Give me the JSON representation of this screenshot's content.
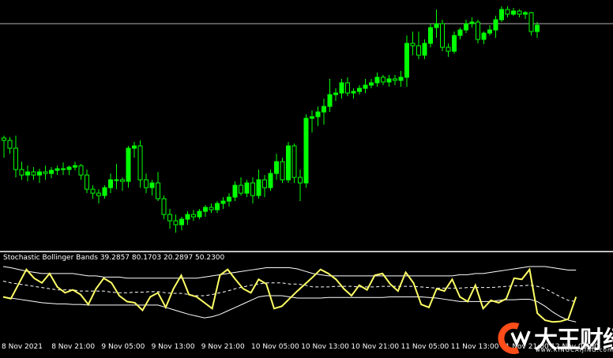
{
  "indicator": {
    "name": "Stochastic Bollinger Bands",
    "values": "39.2857 80.1703 20.2897 50.2300"
  },
  "time_axis": [
    {
      "label": "8 Nov 2021",
      "index": 0
    },
    {
      "label": "8 Nov 21:00",
      "index": 8
    },
    {
      "label": "9 Nov 05:00",
      "index": 16
    },
    {
      "label": "9 Nov 13:00",
      "index": 24
    },
    {
      "label": "9 Nov 21:00",
      "index": 32
    },
    {
      "label": "10 Nov 05:00",
      "index": 40
    },
    {
      "label": "10 Nov 13:00",
      "index": 48
    },
    {
      "label": "10 Nov 21:00",
      "index": 56
    },
    {
      "label": "11 Nov 05:00",
      "index": 64
    },
    {
      "label": "11 Nov 13:00",
      "index": 72
    },
    {
      "label": "11 Nov 21:00",
      "index": 80
    },
    {
      "label": "12 Nov 05:00",
      "index": 88
    }
  ],
  "logo": {
    "text": "大王财经",
    "sub": "www.KINGCAIJING.com"
  },
  "colors": {
    "background": "#000000",
    "candle_bull": "#00ff00",
    "candle_bear": "#000000",
    "candle_wick": "#00ff00",
    "candle_bear_outline": "#00ff00",
    "stoch_line": "#ffff66",
    "band_line": "#ffffff",
    "separator": "#c0c0c0",
    "hline": "#b0b0b0"
  },
  "chart_data": {
    "type": "candlestick",
    "candles": [
      {
        "o": 175,
        "h": 172,
        "l": 200,
        "c": 178
      },
      {
        "o": 178,
        "h": 174,
        "l": 195,
        "c": 188
      },
      {
        "o": 188,
        "h": 172,
        "l": 225,
        "c": 215
      },
      {
        "o": 215,
        "h": 205,
        "l": 228,
        "c": 222
      },
      {
        "o": 222,
        "h": 210,
        "l": 230,
        "c": 218
      },
      {
        "o": 218,
        "h": 212,
        "l": 228,
        "c": 222
      },
      {
        "o": 222,
        "h": 214,
        "l": 232,
        "c": 218
      },
      {
        "o": 218,
        "h": 210,
        "l": 228,
        "c": 220
      },
      {
        "o": 220,
        "h": 212,
        "l": 226,
        "c": 216
      },
      {
        "o": 216,
        "h": 210,
        "l": 222,
        "c": 214
      },
      {
        "o": 214,
        "h": 206,
        "l": 222,
        "c": 215
      },
      {
        "o": 215,
        "h": 210,
        "l": 222,
        "c": 212
      },
      {
        "o": 212,
        "h": 205,
        "l": 216,
        "c": 210
      },
      {
        "o": 210,
        "h": 208,
        "l": 228,
        "c": 222
      },
      {
        "o": 222,
        "h": 215,
        "l": 245,
        "c": 240
      },
      {
        "o": 240,
        "h": 235,
        "l": 252,
        "c": 245
      },
      {
        "o": 245,
        "h": 240,
        "l": 258,
        "c": 248
      },
      {
        "o": 248,
        "h": 235,
        "l": 252,
        "c": 238
      },
      {
        "o": 238,
        "h": 220,
        "l": 245,
        "c": 228
      },
      {
        "o": 228,
        "h": 208,
        "l": 240,
        "c": 228
      },
      {
        "o": 228,
        "h": 225,
        "l": 242,
        "c": 230
      },
      {
        "o": 230,
        "h": 185,
        "l": 238,
        "c": 188
      },
      {
        "o": 188,
        "h": 180,
        "l": 200,
        "c": 185
      },
      {
        "o": 185,
        "h": 178,
        "l": 238,
        "c": 228
      },
      {
        "o": 228,
        "h": 220,
        "l": 245,
        "c": 238
      },
      {
        "o": 238,
        "h": 228,
        "l": 248,
        "c": 232
      },
      {
        "o": 232,
        "h": 218,
        "l": 255,
        "c": 252
      },
      {
        "o": 252,
        "h": 248,
        "l": 278,
        "c": 272
      },
      {
        "o": 272,
        "h": 265,
        "l": 290,
        "c": 280
      },
      {
        "o": 280,
        "h": 272,
        "l": 295,
        "c": 285
      },
      {
        "o": 285,
        "h": 275,
        "l": 292,
        "c": 278
      },
      {
        "o": 278,
        "h": 268,
        "l": 285,
        "c": 272
      },
      {
        "o": 272,
        "h": 266,
        "l": 280,
        "c": 275
      },
      {
        "o": 275,
        "h": 265,
        "l": 278,
        "c": 268
      },
      {
        "o": 268,
        "h": 260,
        "l": 275,
        "c": 263
      },
      {
        "o": 263,
        "h": 258,
        "l": 270,
        "c": 266
      },
      {
        "o": 266,
        "h": 255,
        "l": 270,
        "c": 258
      },
      {
        "o": 258,
        "h": 250,
        "l": 265,
        "c": 255
      },
      {
        "o": 255,
        "h": 245,
        "l": 262,
        "c": 250
      },
      {
        "o": 250,
        "h": 230,
        "l": 255,
        "c": 235
      },
      {
        "o": 235,
        "h": 225,
        "l": 248,
        "c": 245
      },
      {
        "o": 245,
        "h": 228,
        "l": 250,
        "c": 232
      },
      {
        "o": 232,
        "h": 225,
        "l": 258,
        "c": 248
      },
      {
        "o": 248,
        "h": 215,
        "l": 252,
        "c": 228
      },
      {
        "o": 228,
        "h": 222,
        "l": 250,
        "c": 238
      },
      {
        "o": 238,
        "h": 215,
        "l": 242,
        "c": 220
      },
      {
        "o": 220,
        "h": 195,
        "l": 228,
        "c": 205
      },
      {
        "o": 205,
        "h": 200,
        "l": 232,
        "c": 228
      },
      {
        "o": 228,
        "h": 180,
        "l": 232,
        "c": 185
      },
      {
        "o": 185,
        "h": 182,
        "l": 232,
        "c": 225
      },
      {
        "o": 225,
        "h": 215,
        "l": 255,
        "c": 232
      },
      {
        "o": 232,
        "h": 145,
        "l": 238,
        "c": 150
      },
      {
        "o": 150,
        "h": 140,
        "l": 168,
        "c": 148
      },
      {
        "o": 148,
        "h": 135,
        "l": 160,
        "c": 142
      },
      {
        "o": 142,
        "h": 125,
        "l": 158,
        "c": 135
      },
      {
        "o": 135,
        "h": 100,
        "l": 142,
        "c": 120
      },
      {
        "o": 120,
        "h": 112,
        "l": 128,
        "c": 118
      },
      {
        "o": 118,
        "h": 100,
        "l": 125,
        "c": 105
      },
      {
        "o": 105,
        "h": 98,
        "l": 122,
        "c": 118
      },
      {
        "o": 118,
        "h": 112,
        "l": 125,
        "c": 116
      },
      {
        "o": 116,
        "h": 108,
        "l": 120,
        "c": 112
      },
      {
        "o": 112,
        "h": 100,
        "l": 118,
        "c": 108
      },
      {
        "o": 108,
        "h": 100,
        "l": 112,
        "c": 105
      },
      {
        "o": 105,
        "h": 92,
        "l": 110,
        "c": 98
      },
      {
        "o": 98,
        "h": 95,
        "l": 108,
        "c": 104
      },
      {
        "o": 104,
        "h": 95,
        "l": 110,
        "c": 100
      },
      {
        "o": 100,
        "h": 95,
        "l": 108,
        "c": 102
      },
      {
        "o": 102,
        "h": 90,
        "l": 110,
        "c": 98
      },
      {
        "o": 98,
        "h": 45,
        "l": 110,
        "c": 55
      },
      {
        "o": 55,
        "h": 40,
        "l": 70,
        "c": 58
      },
      {
        "o": 58,
        "h": 40,
        "l": 75,
        "c": 70
      },
      {
        "o": 70,
        "h": 50,
        "l": 75,
        "c": 55
      },
      {
        "o": 55,
        "h": 30,
        "l": 60,
        "c": 35
      },
      {
        "o": 35,
        "h": 12,
        "l": 48,
        "c": 30
      },
      {
        "o": 30,
        "h": 25,
        "l": 65,
        "c": 60
      },
      {
        "o": 60,
        "h": 55,
        "l": 72,
        "c": 65
      },
      {
        "o": 65,
        "h": 40,
        "l": 68,
        "c": 45
      },
      {
        "o": 45,
        "h": 35,
        "l": 50,
        "c": 38
      },
      {
        "o": 38,
        "h": 25,
        "l": 42,
        "c": 30
      },
      {
        "o": 30,
        "h": 22,
        "l": 35,
        "c": 28
      },
      {
        "o": 28,
        "h": 25,
        "l": 55,
        "c": 50
      },
      {
        "o": 50,
        "h": 40,
        "l": 56,
        "c": 42
      },
      {
        "o": 42,
        "h": 32,
        "l": 45,
        "c": 38
      },
      {
        "o": 38,
        "h": 20,
        "l": 48,
        "c": 25
      },
      {
        "o": 25,
        "h": 8,
        "l": 28,
        "c": 12
      },
      {
        "o": 12,
        "h": 8,
        "l": 22,
        "c": 18
      },
      {
        "o": 18,
        "h": 10,
        "l": 20,
        "c": 14
      },
      {
        "o": 14,
        "h": 12,
        "l": 22,
        "c": 18
      },
      {
        "o": 18,
        "h": 14,
        "l": 24,
        "c": 16
      },
      {
        "o": 16,
        "h": 15,
        "l": 45,
        "c": 40
      },
      {
        "o": 40,
        "h": 28,
        "l": 48,
        "c": 32
      }
    ],
    "stoch": [
      48,
      45,
      70,
      95,
      80,
      72,
      88,
      65,
      55,
      60,
      52,
      35,
      62,
      80,
      72,
      50,
      40,
      38,
      25,
      48,
      55,
      30,
      62,
      85,
      52,
      48,
      38,
      28,
      85,
      95,
      78,
      62,
      55,
      78,
      70,
      28,
      32,
      45,
      58,
      70,
      82,
      95,
      88,
      78,
      62,
      50,
      68,
      60,
      85,
      88,
      70,
      58,
      90,
      72,
      35,
      30,
      62,
      58,
      78,
      48,
      40,
      68,
      28,
      42,
      38,
      45,
      80,
      78,
      95,
      20,
      8,
      5,
      6,
      10,
      48
    ],
    "band_upper": [
      100,
      98,
      95,
      92,
      90,
      88,
      88,
      88,
      88,
      88,
      86,
      84,
      84,
      82,
      82,
      82,
      80,
      80,
      80,
      80,
      80,
      80,
      80,
      80,
      80,
      80,
      82,
      84,
      86,
      88,
      90,
      92,
      94,
      96,
      98,
      98,
      98,
      98,
      96,
      92,
      88,
      86,
      84,
      84,
      84,
      84,
      84,
      84,
      84,
      84,
      84,
      84,
      84,
      84,
      84,
      84,
      84,
      84,
      84,
      86,
      86,
      88,
      88,
      90,
      92,
      94,
      96,
      98,
      100,
      100,
      100,
      98,
      96,
      94,
      94
    ],
    "band_mid": [
      75,
      72,
      70,
      68,
      66,
      64,
      62,
      60,
      60,
      60,
      58,
      58,
      58,
      58,
      56,
      55,
      55,
      56,
      56,
      57,
      57,
      55,
      54,
      54,
      52,
      50,
      50,
      52,
      55,
      58,
      62,
      65,
      68,
      70,
      72,
      72,
      72,
      70,
      70,
      68,
      65,
      65,
      65,
      66,
      66,
      66,
      65,
      65,
      65,
      66,
      66,
      66,
      66,
      66,
      65,
      64,
      63,
      63,
      63,
      63,
      64,
      64,
      64,
      64,
      65,
      66,
      67,
      67,
      68,
      66,
      62,
      55,
      48,
      42,
      40
    ],
    "band_lower": [
      48,
      46,
      44,
      42,
      40,
      38,
      37,
      36,
      36,
      35,
      35,
      34,
      34,
      34,
      34,
      34,
      34,
      34,
      34,
      34,
      34,
      30,
      26,
      22,
      18,
      15,
      12,
      14,
      18,
      24,
      30,
      36,
      42,
      48,
      50,
      50,
      50,
      48,
      46,
      46,
      46,
      46,
      47,
      47,
      47,
      47,
      47,
      47,
      47,
      47,
      48,
      48,
      48,
      48,
      48,
      47,
      46,
      44,
      42,
      40,
      40,
      40,
      40,
      40,
      42,
      43,
      43,
      44,
      44,
      40,
      32,
      22,
      14,
      8,
      5
    ],
    "price_hline_level": 30
  }
}
